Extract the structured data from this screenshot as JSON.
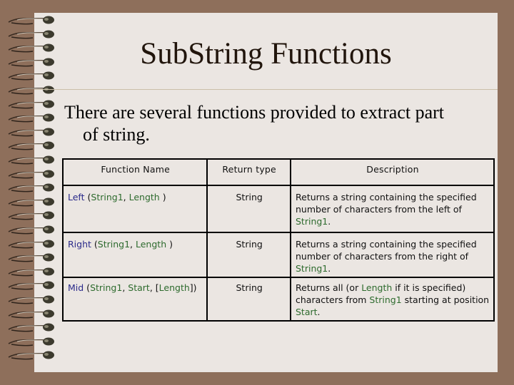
{
  "slide": {
    "title": "SubString Functions",
    "intro_line1": "There are several functions provided to extract part",
    "intro_line2": "of string."
  },
  "colors": {
    "background": "#8e6f5b",
    "paper": "#ebe6e2",
    "function_name": "#2a2a8a",
    "argument": "#2e6b2e",
    "text": "#111111"
  },
  "table": {
    "headers": [
      "Function Name",
      "Return type",
      "Description"
    ],
    "rows": [
      {
        "fn": "Left",
        "sig": [
          " (",
          "String1",
          ", ",
          "Length",
          " )"
        ],
        "return_type": "String",
        "desc": [
          "Returns a string containing the specified number of characters from the left of ",
          "String1",
          "."
        ]
      },
      {
        "fn": "Right",
        "sig": [
          " (",
          "String1",
          ", ",
          "Length",
          " )"
        ],
        "return_type": "String",
        "desc": [
          "Returns a string containing the specified number of characters from the right of ",
          "String1",
          "."
        ]
      },
      {
        "fn": "Mid",
        "sig": [
          " (",
          "String1",
          ", ",
          "Start",
          ", [",
          "Length",
          "])"
        ],
        "return_type": "String",
        "desc": [
          "Returns all (or ",
          "Length",
          " if it is specified) characters from ",
          "String1",
          " starting at position ",
          "Start",
          "."
        ]
      }
    ]
  },
  "decor": {
    "spiral_icon": "spiral-binding-coil",
    "coil_count": 25
  }
}
